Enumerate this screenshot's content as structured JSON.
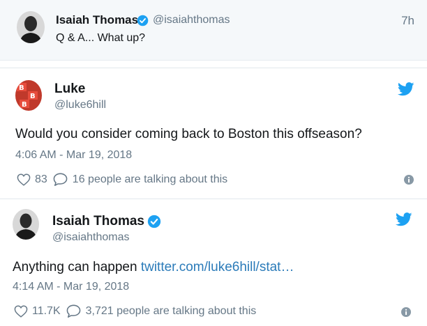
{
  "reply_context": {
    "author_name": "Isaiah Thomas",
    "author_handle": "@isaiahthomas",
    "time_ago": "7h",
    "text": "Q & A... What up?"
  },
  "tweets": [
    {
      "author_name": "Luke",
      "author_handle": "@luke6hill",
      "text": "Would you consider coming back to Boston this offseason?",
      "link_text": "",
      "timestamp": "4:06 AM - Mar 19, 2018",
      "likes": "83",
      "talking": "16 people are talking about this"
    },
    {
      "author_name": "Isaiah Thomas",
      "author_handle": "@isaiahthomas",
      "text": "Anything can happen",
      "link_text": "twitter.com/luke6hill/stat…",
      "timestamp": "4:14 AM - Mar 19, 2018",
      "likes": "11.7K",
      "talking": "3,721 people are talking about this"
    }
  ],
  "colors": {
    "twitter_blue": "#1da1f2",
    "link_blue": "#2b7bb9",
    "secondary_text": "#657786",
    "background_context": "#f5f8fa"
  },
  "icons": {
    "verified": "verified-badge-icon",
    "bird": "twitter-bird-icon",
    "heart": "heart-icon",
    "reply": "speech-bubble-icon",
    "info": "info-icon"
  }
}
